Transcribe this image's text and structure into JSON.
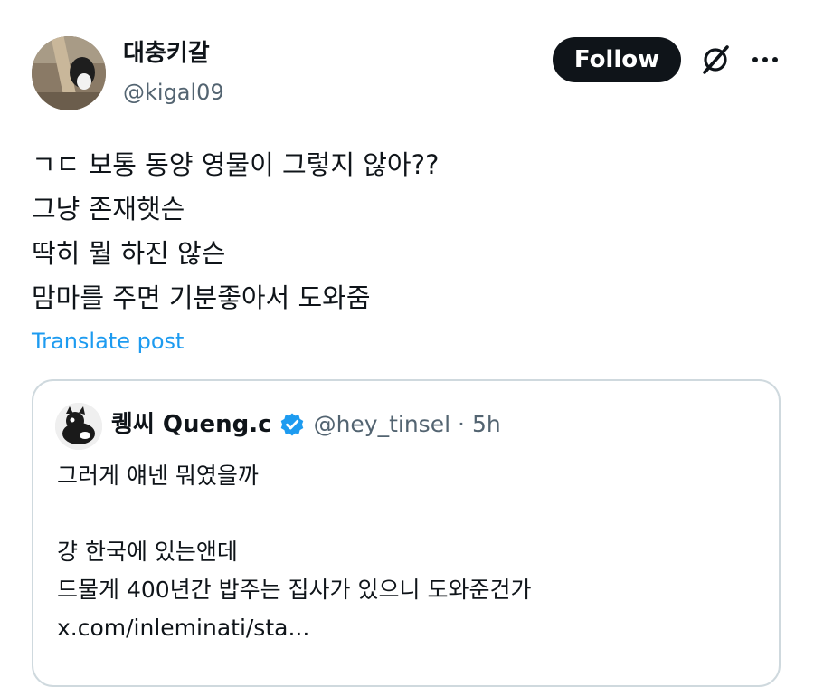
{
  "author": {
    "display_name": "대충키갈",
    "handle": "@kigal09",
    "avatar": "profile-photo"
  },
  "actions": {
    "follow_label": "Follow",
    "grok_icon": "grok-slash-icon",
    "more_icon": "more-dots-icon"
  },
  "post": {
    "lines": [
      "ㄱㄷ 보통 동양 영물이 그렇지 않아??",
      "그냥 존재햇슨",
      "딱히 뭘 하진 않슨",
      "맘마를 주면 기분좋아서 도와줌"
    ],
    "translate_label": "Translate post"
  },
  "quote": {
    "display_name": "퀭씨 Queng.c",
    "verified": true,
    "handle": "@hey_tinsel",
    "separator": "·",
    "time": "5h",
    "lines": [
      "그러게 얘넨 뭐였을까",
      "",
      "걍 한국에 있는앤데",
      "드물게 400년간 밥주는 집사가 있으니 도와준건가",
      "x.com/inleminati/sta..."
    ]
  },
  "colors": {
    "text": "#0f1419",
    "secondary": "#536471",
    "link": "#1d9bf0",
    "border": "#cfd9de",
    "verified": "#1d9bf0"
  }
}
